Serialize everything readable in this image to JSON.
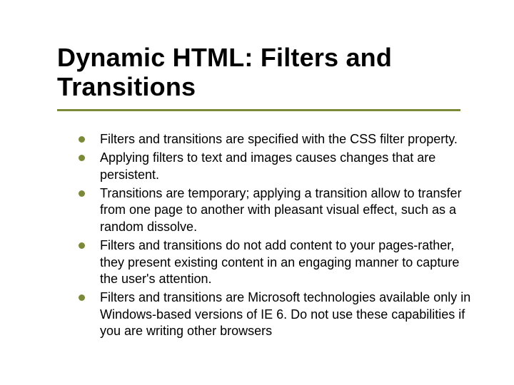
{
  "title": "Dynamic HTML: Filters and Transitions",
  "bullets": [
    "Filters and transitions are specified with the CSS filter property.",
    "Applying filters to text and images causes changes that are persistent.",
    "Transitions are temporary; applying a transition allow to transfer from one page to another with pleasant visual effect, such as a random dissolve.",
    "Filters and transitions do not add content to your pages-rather, they present existing content in an engaging manner to capture the user's attention.",
    "Filters and transitions are Microsoft technologies available only in Windows-based versions of IE 6. Do not use these capabilities if you are writing other browsers"
  ]
}
